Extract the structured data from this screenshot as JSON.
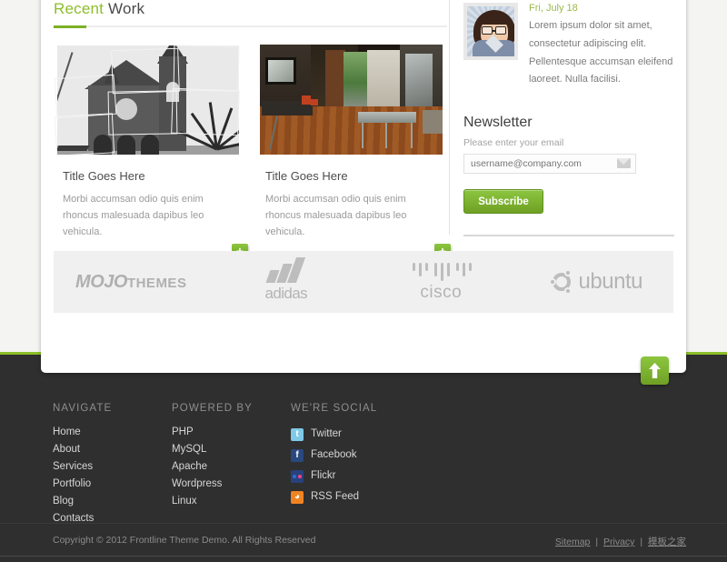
{
  "theme": {
    "accent_green": "#8cbf2a",
    "btn_green_top": "#8cc63f",
    "btn_green_bottom": "#6fa024",
    "dark_footer": "#2f2f2f",
    "page_bg": "#f4f4f2",
    "logo_gray": "#b4b4b4"
  },
  "recent_work": {
    "title_highlight": "Recent",
    "title_rest": " Work",
    "items": [
      {
        "image_name": "church-bw-collage-photo",
        "title": "Title Goes Here",
        "description": "Morbi accumsan odio quis enim rhoncus malesuada dapibus leo vehicula.",
        "plus_label": "+"
      },
      {
        "image_name": "interior-room-photo",
        "title": "Title Goes Here",
        "description": "Morbi accumsan odio quis enim rhoncus malesuada dapibus leo vehicula.",
        "plus_label": "+"
      }
    ]
  },
  "sidebar": {
    "news": {
      "avatar_name": "woman-with-glasses-avatar",
      "date": "Fri, July 18",
      "text": "Lorem ipsum dolor sit amet, consectetur adipiscing elit. Pellentesque accumsan eleifend laoreet. Nulla facilisi."
    },
    "newsletter": {
      "title": "Newsletter",
      "label": "Please enter your email",
      "input_value": "",
      "input_placeholder": "username@company.com",
      "input_icon": "envelope-icon",
      "submit_label": "Subscribe"
    }
  },
  "clients": [
    {
      "name": "MOJO THEMES",
      "mark": "mojo-themes-logo",
      "word1": "MOJO",
      "word2": "THEMES"
    },
    {
      "name": "adidas",
      "mark": "adidas-logo",
      "word": "adidas"
    },
    {
      "name": "cisco",
      "mark": "cisco-logo",
      "word": "cisco"
    },
    {
      "name": "ubuntu",
      "mark": "ubuntu-logo",
      "word": "ubuntu"
    }
  ],
  "scroll_top": {
    "icon": "arrow-up-icon"
  },
  "footer": {
    "columns": [
      {
        "heading": "NAVIGATE",
        "items": [
          "Home",
          "About",
          "Services",
          "Portfolio",
          "Blog",
          "Contacts"
        ]
      },
      {
        "heading": "POWERED BY",
        "items": [
          "PHP",
          "MySQL",
          "Apache",
          "Wordpress",
          "Linux"
        ]
      }
    ],
    "social": {
      "heading": "WE'RE SOCIAL",
      "items": [
        {
          "label": "Twitter",
          "icon": "twitter-icon",
          "glyph": "t",
          "color": "#7ec9e8"
        },
        {
          "label": "Facebook",
          "icon": "facebook-icon",
          "glyph": "f",
          "color": "#29487d"
        },
        {
          "label": "Flickr",
          "icon": "flickr-icon",
          "glyph": "",
          "color": "#27427c"
        },
        {
          "label": "RSS Feed",
          "icon": "rss-icon",
          "glyph": "◔",
          "color": "#f08322"
        }
      ]
    },
    "copyright": "Copyright © 2012 Frontline Theme Demo. All Rights Reserved",
    "legal": {
      "sitemap": "Sitemap",
      "privacy": "Privacy",
      "extra": "模板之家",
      "separator": "|"
    }
  }
}
